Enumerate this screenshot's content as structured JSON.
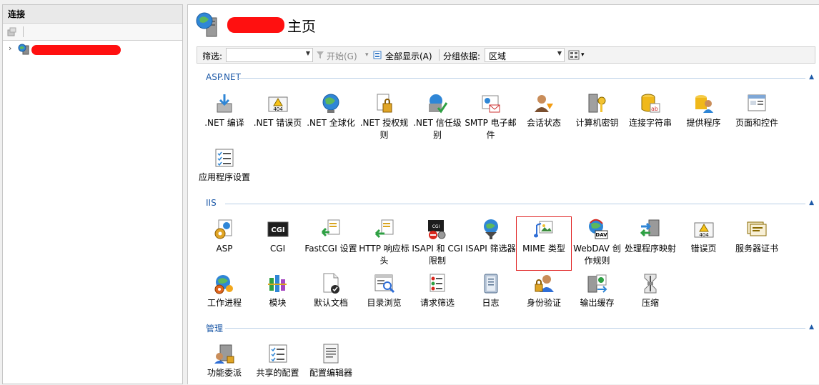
{
  "left": {
    "title": "连接",
    "tree": {
      "expander": "›"
    }
  },
  "header": {
    "title_suffix": "主页"
  },
  "filter": {
    "label": "筛选:",
    "value": "",
    "start_label": "开始(G)",
    "show_all_label": "全部显示(A)",
    "group_by_label": "分组依据:",
    "group_value": "区域"
  },
  "sections": [
    {
      "title": "ASP.NET",
      "items": [
        {
          "label": ".NET 编译",
          "icon": "download-icon"
        },
        {
          "label": ".NET 错误页",
          "icon": "warning-404-icon"
        },
        {
          "label": ".NET 全球化",
          "icon": "globe-icon"
        },
        {
          "label": ".NET 授权规则",
          "icon": "lock-doc-icon"
        },
        {
          "label": ".NET 信任级别",
          "icon": "trust-check-icon"
        },
        {
          "label": "SMTP 电子邮件",
          "icon": "email-icon"
        },
        {
          "label": "会话状态",
          "icon": "session-user-icon"
        },
        {
          "label": "计算机密钥",
          "icon": "key-icon"
        },
        {
          "label": "连接字符串",
          "icon": "database-icon"
        },
        {
          "label": "提供程序",
          "icon": "provider-icon"
        },
        {
          "label": "页面和控件",
          "icon": "page-controls-icon"
        },
        {
          "label": "应用程序设置",
          "icon": "settings-list-icon"
        }
      ]
    },
    {
      "title": "IIS",
      "items": [
        {
          "label": "ASP",
          "icon": "asp-gear-icon"
        },
        {
          "label": "CGI",
          "icon": "cgi-icon"
        },
        {
          "label": "FastCGI 设置",
          "icon": "fastcgi-icon"
        },
        {
          "label": "HTTP 响应标头",
          "icon": "http-header-icon"
        },
        {
          "label": "ISAPI 和 CGI 限制",
          "icon": "isapi-restrict-icon"
        },
        {
          "label": "ISAPI 筛选器",
          "icon": "filter-funnel-icon"
        },
        {
          "label": "MIME 类型",
          "icon": "mime-icon"
        },
        {
          "label": "WebDAV 创作规则",
          "icon": "webdav-icon"
        },
        {
          "label": "处理程序映射",
          "icon": "handler-map-icon"
        },
        {
          "label": "错误页",
          "icon": "warning-404-icon"
        },
        {
          "label": "服务器证书",
          "icon": "certificate-icon"
        },
        {
          "label": "工作进程",
          "icon": "worker-process-icon"
        },
        {
          "label": "模块",
          "icon": "module-icon"
        },
        {
          "label": "默认文档",
          "icon": "default-doc-icon"
        },
        {
          "label": "目录浏览",
          "icon": "directory-browse-icon"
        },
        {
          "label": "请求筛选",
          "icon": "request-filter-icon"
        },
        {
          "label": "日志",
          "icon": "log-icon"
        },
        {
          "label": "身份验证",
          "icon": "auth-user-icon"
        },
        {
          "label": "输出缓存",
          "icon": "output-cache-icon"
        },
        {
          "label": "压缩",
          "icon": "compress-icon"
        }
      ]
    },
    {
      "title": "管理",
      "items": [
        {
          "label": "功能委派",
          "icon": "delegation-icon"
        },
        {
          "label": "共享的配置",
          "icon": "shared-config-icon"
        },
        {
          "label": "配置编辑器",
          "icon": "config-editor-icon"
        }
      ]
    }
  ],
  "selected_item": "MIME 类型",
  "colors": {
    "section": "#1e5aa8",
    "selection": "#e02020",
    "redaction": "#ff1010"
  }
}
